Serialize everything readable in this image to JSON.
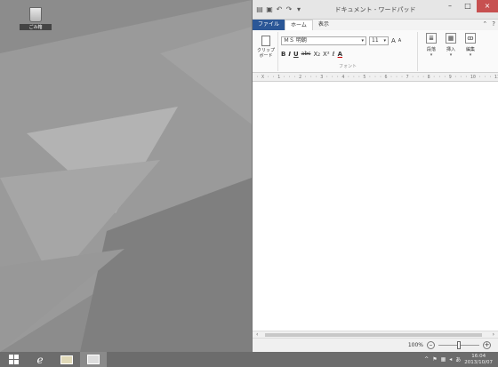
{
  "desktop": {
    "recycle_bin_label": "ごみ箱"
  },
  "window": {
    "title": "ドキュメント - ワードパッド",
    "controls": {
      "minimize": "–",
      "maximize": "□",
      "close": "×"
    },
    "qat": {
      "save": "▣",
      "undo": "↶",
      "redo": "↷",
      "customize": "▾"
    }
  },
  "tabs": [
    {
      "label": "ファイル"
    },
    {
      "label": "ホーム"
    },
    {
      "label": "表示"
    }
  ],
  "ribbon": {
    "clipboard_label": "クリップ ボード",
    "font_name": "ＭＳ 明朝",
    "font_size": "11",
    "grow": "A",
    "shrink": "A",
    "bold": "B",
    "italic": "I",
    "underline": "U",
    "strike": "abc",
    "sub": "X₂",
    "sup": "X²",
    "highlight": "ℓ",
    "color": "A",
    "font_group_label": "フォント",
    "paragraph_label": "段落",
    "insert_label": "挿入",
    "edit_label": "編集"
  },
  "ruler": "· X · · 1 · · · 2 · · · 3 · · · 4 · · · 5 · · · 6 · · · 7 · · · 8 · · · 9 · · · 10 · · · 11 · · · 12 · ·",
  "status": {
    "zoom": "100%",
    "zoom_out": "–",
    "zoom_in": "+",
    "zoom_level": 0.5
  },
  "taskbar": {
    "time": "16:04",
    "date": "2013/10/07"
  }
}
